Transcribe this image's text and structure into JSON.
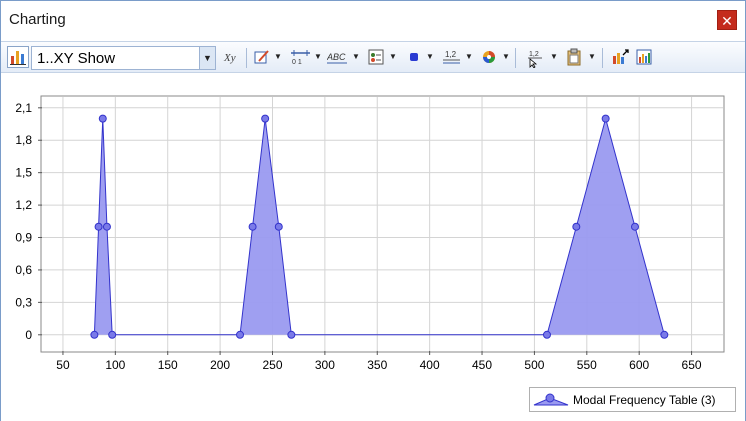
{
  "window": {
    "title": "Charting",
    "close_glyph": "✕"
  },
  "toolbar": {
    "chart_selector": "1..XY Show",
    "dropdown_arrow": "▼",
    "icons": [
      "chart-icon",
      "axis-font-icon",
      "edit-icon",
      "axis-scale-icon",
      "text-labels-icon",
      "legend-icon",
      "marker-icon",
      "number-format-icon",
      "color-palette-icon",
      "pointer-value-icon",
      "clipboard-icon",
      "export-chart-icon",
      "print-chart-icon"
    ]
  },
  "legend": {
    "label": "Modal Frequency Table (3)"
  },
  "colors": {
    "fill": "#9a9af0",
    "line": "#3333cc",
    "marker": "#7a7ae8",
    "grid": "#d4d4d4",
    "window_border": "#7a9cc9",
    "close": "#c42b1c"
  },
  "chart_data": {
    "type": "area",
    "series": [
      {
        "name": "Modal Frequency Table (3)",
        "x": [
          80,
          84,
          88,
          92,
          97,
          219,
          231,
          243,
          256,
          268,
          512,
          540,
          568,
          596,
          624
        ],
        "y": [
          0,
          1.0,
          2.0,
          1.0,
          0,
          0,
          1.0,
          2.0,
          1.0,
          0,
          0,
          1.0,
          2.0,
          1.0,
          0
        ]
      }
    ],
    "xlim": [
      30,
      680
    ],
    "ylim": [
      -0.15,
      2.2
    ],
    "xticks": [
      50,
      100,
      150,
      200,
      250,
      300,
      350,
      400,
      450,
      500,
      550,
      600,
      650
    ],
    "yticks": [
      0,
      0.3,
      0.6,
      0.9,
      1.2,
      1.5,
      1.8,
      2.1
    ],
    "ytick_labels": [
      "0",
      "0,3",
      "0,6",
      "0,9",
      "1,2",
      "1,5",
      "1,8",
      "2,1"
    ],
    "grid": true,
    "legend_position": "bottom-right"
  }
}
